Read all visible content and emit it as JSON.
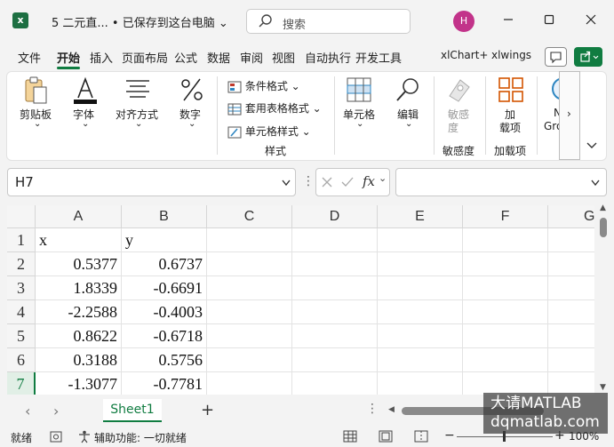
{
  "titlebar": {
    "app_icon_letter": "x",
    "doc_title": "5 二元直... • 已保存到这台电脑",
    "search_placeholder": "搜索",
    "avatar_initial": "H"
  },
  "menu_tabs": [
    "文件",
    "开始",
    "插入",
    "页面布局",
    "公式",
    "数据",
    "审阅",
    "视图",
    "自动执行",
    "开发工具",
    "xlChart+",
    "xlwings"
  ],
  "active_tab": "开始",
  "ribbon": {
    "clipboard": "剪贴板",
    "font": "字体",
    "alignment": "对齐方式",
    "number": "数字",
    "conditional_format": "条件格式",
    "table_format": "套用表格格式",
    "cell_style": "单元格样式",
    "styles_group": "样式",
    "cells": "单元格",
    "editing": "编辑",
    "sensitivity_top": "敏感",
    "sensitivity_bottom": "度",
    "sensitivity_group": "敏感度",
    "addins_top": "加",
    "addins_bottom": "载项",
    "addins_group": "加载项",
    "extra_top": "N",
    "extra_bottom": "Gro"
  },
  "formula_bar": {
    "name_box": "H7",
    "fx_label": "fx",
    "formula": ""
  },
  "columns": [
    "A",
    "B",
    "C",
    "D",
    "E",
    "F",
    "G"
  ],
  "rows": [
    {
      "num": "1",
      "a": "x",
      "b": "y"
    },
    {
      "num": "2",
      "a": "0.5377",
      "b": "0.6737"
    },
    {
      "num": "3",
      "a": "1.8339",
      "b": "-0.6691"
    },
    {
      "num": "4",
      "a": "-2.2588",
      "b": "-0.4003"
    },
    {
      "num": "5",
      "a": "0.8622",
      "b": "-0.6718"
    },
    {
      "num": "6",
      "a": "0.3188",
      "b": "0.5756"
    },
    {
      "num": "7",
      "a": "-1.3077",
      "b": "-0.7781"
    }
  ],
  "selected_row": "7",
  "sheet_tab": "Sheet1",
  "statusbar": {
    "ready": "就绪",
    "accessibility": "辅助功能: 一切就绪",
    "zoom": "100%"
  },
  "watermark": {
    "line1": "大请MATLAB",
    "line2": "dqmatlab.com"
  },
  "colors": {
    "excel_green": "#107c41",
    "avatar": "#c2338a"
  }
}
